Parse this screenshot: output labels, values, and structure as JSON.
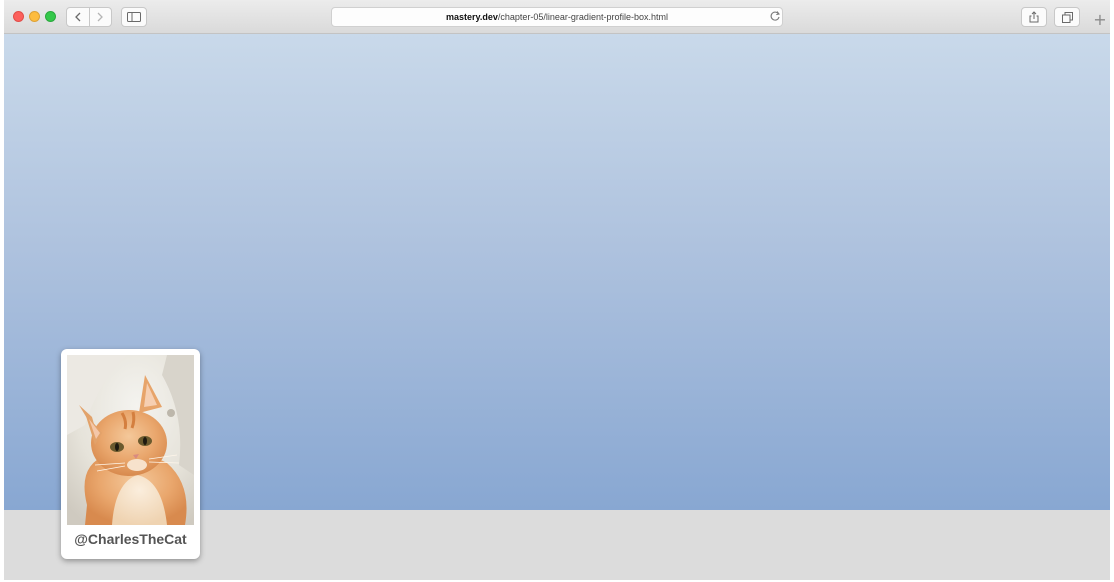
{
  "browser": {
    "url_host": "mastery.dev",
    "url_path": "/chapter-05/linear-gradient-profile-box.html",
    "icons": [
      "back-arrow-icon",
      "forward-arrow-icon",
      "sidebar-icon",
      "reload-icon",
      "share-icon",
      "tabs-icon",
      "new-tab-plus-icon"
    ],
    "new_tab_symbol": "+"
  },
  "colors": {
    "banner_top": "#c9d9ea",
    "banner_bottom": "#88a7d2",
    "page_background": "#dcdcdc",
    "handle_text": "#555555"
  },
  "profile": {
    "handle": "@CharlesTheCat",
    "photo_subject": "orange-tabby-kitten"
  }
}
